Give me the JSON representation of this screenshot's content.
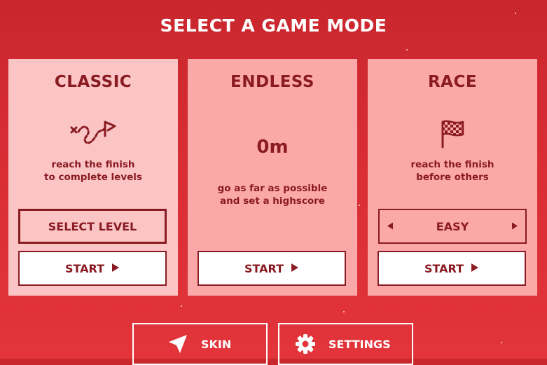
{
  "header": {
    "title": "SELECT A GAME MODE"
  },
  "modes": {
    "classic": {
      "title": "CLASSIC",
      "icon": "winding-path-flag-icon",
      "desc_line1": "reach the finish",
      "desc_line2": "to complete levels",
      "select_level_label": "SELECT LEVEL",
      "start_label": "START"
    },
    "endless": {
      "title": "ENDLESS",
      "distance": "0m",
      "desc_line1": "go as far as possible",
      "desc_line2": "and set a highscore",
      "start_label": "START"
    },
    "race": {
      "title": "RACE",
      "icon": "checkered-flag-icon",
      "desc_line1": "reach the finish",
      "desc_line2": "before others",
      "difficulty": "EASY",
      "start_label": "START"
    }
  },
  "footer": {
    "skin_label": "SKIN",
    "skin_icon": "paper-plane-icon",
    "settings_label": "SETTINGS",
    "settings_icon": "gear-icon"
  },
  "colors": {
    "background": "#d92d34",
    "accent_dark": "#8a1b22",
    "card_light": "#fbc5c5",
    "card": "#fba9a8",
    "white": "#ffffff"
  }
}
